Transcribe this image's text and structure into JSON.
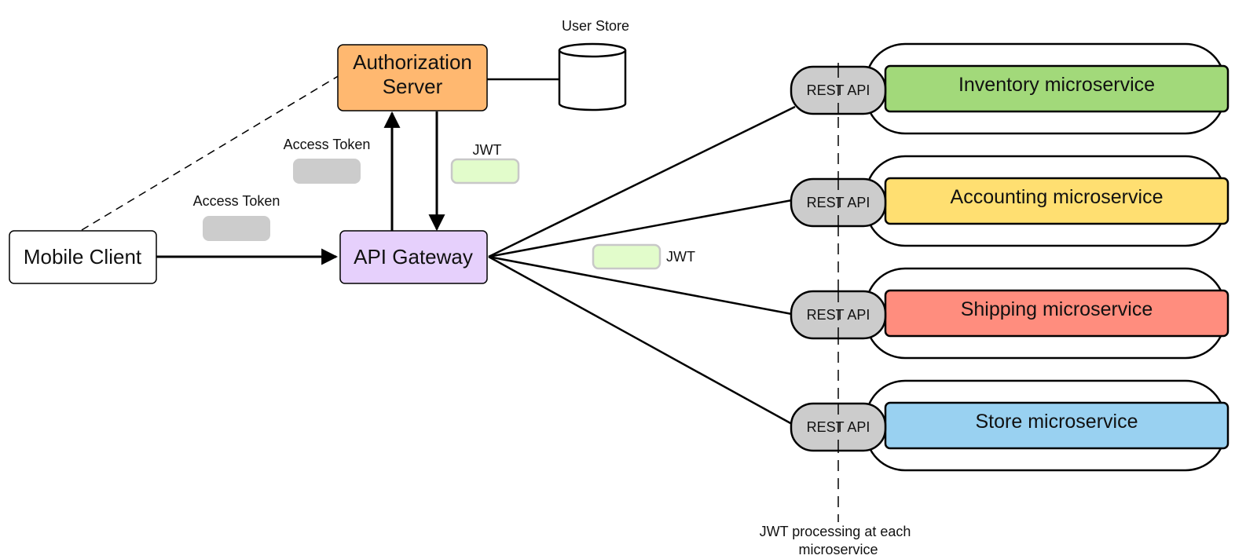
{
  "nodes": {
    "mobile_client": {
      "label": "Mobile Client",
      "fill": "#ffffff"
    },
    "api_gateway": {
      "label": "API Gateway",
      "fill": "#e6d0fc"
    },
    "auth_server": {
      "label_line1": "Authorization",
      "label_line2": "Server",
      "fill": "#ffb870"
    },
    "user_store": {
      "label": "User Store",
      "fill": "#ffffff"
    }
  },
  "tokens": {
    "access_token_1": {
      "label": "Access Token",
      "fill": "#cccccc"
    },
    "access_token_2": {
      "label": "Access Token",
      "fill": "#cccccc"
    },
    "jwt_1": {
      "label": "JWT",
      "fill": "#e2fccb"
    },
    "jwt_2": {
      "label": "JWT",
      "fill": "#e2fccb"
    }
  },
  "rest_api_label": "REST API",
  "microservices": [
    {
      "label": "Inventory microservice",
      "fill": "#a2d97a"
    },
    {
      "label": "Accounting microservice",
      "fill": "#ffdf71"
    },
    {
      "label": "Shipping microservice",
      "fill": "#ff8d7e"
    },
    {
      "label": "Store microservice",
      "fill": "#99d1f1"
    }
  ],
  "annotation": {
    "line1": "JWT processing at each",
    "line2": "microservice"
  }
}
